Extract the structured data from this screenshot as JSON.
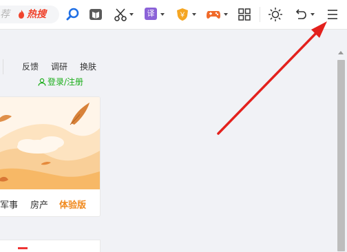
{
  "toolbar": {
    "search_placeholder_fragment": "荐",
    "hot_search_label": "热搜",
    "icons": [
      "search-icon",
      "reader-mode-icon",
      "screenshot-scissors-icon",
      "translate-icon",
      "coupon-shield-icon",
      "game-controller-icon",
      "apps-grid-icon",
      "brightness-sun-icon",
      "undo-icon",
      "menu-icon"
    ],
    "translate_glyph": "译",
    "coupon_glyph": "￥"
  },
  "header_links": {
    "feedback": "反馈",
    "survey": "调研",
    "skin": "换肤",
    "login": "登录/注册"
  },
  "card_nav": {
    "military": "军事",
    "real_estate": "房产",
    "experience": "体验版"
  },
  "colors": {
    "accent_green": "#1aad19",
    "accent_orange": "#f08a1f",
    "annotation_red": "#e3211d",
    "hot_red": "#f0432c"
  }
}
